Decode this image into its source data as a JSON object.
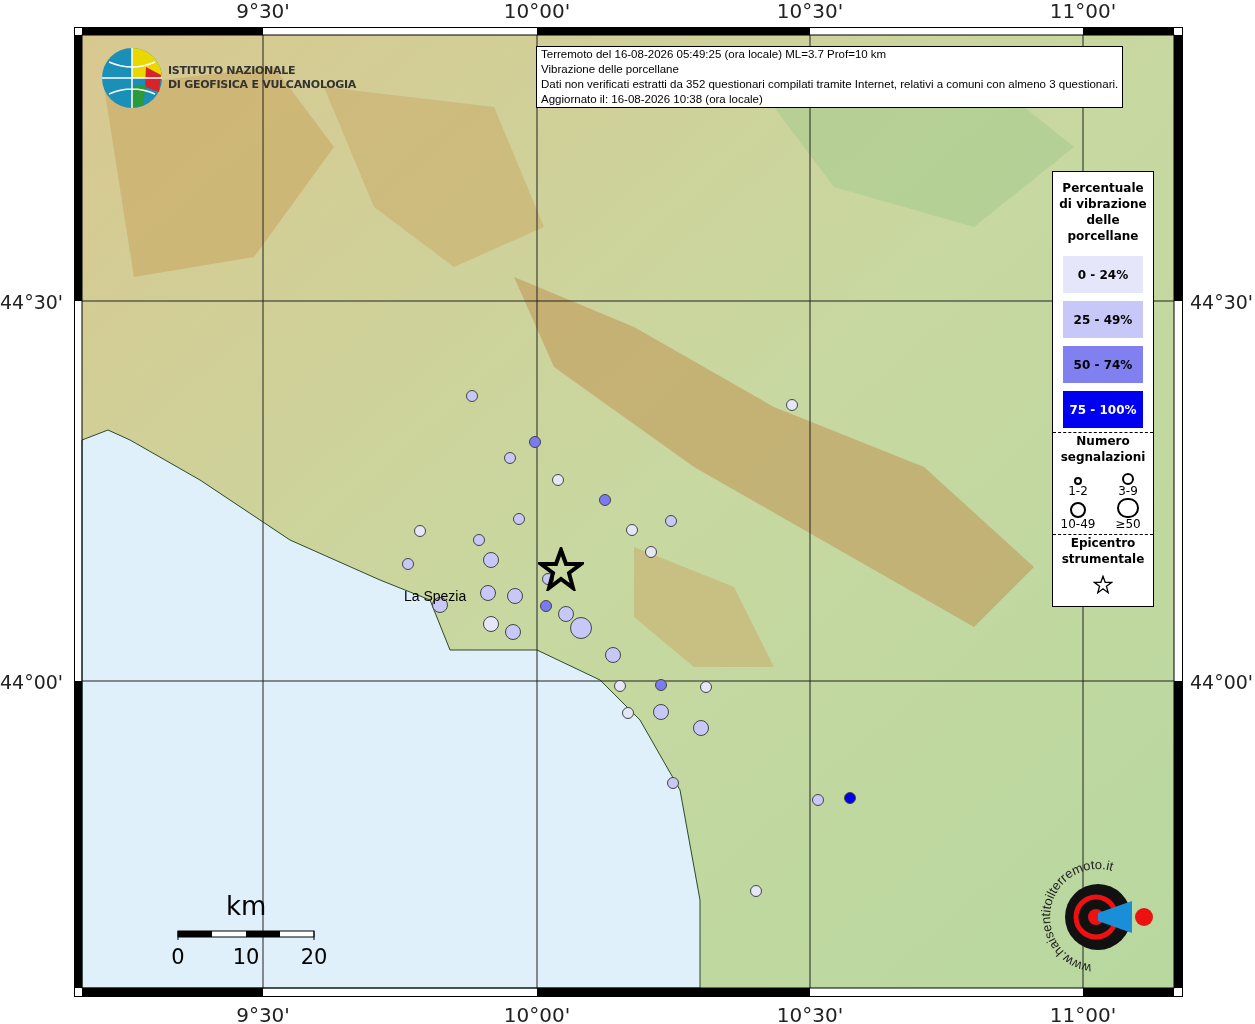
{
  "map": {
    "top_ticks": [
      "9°30'",
      "10°00'",
      "10°30'",
      "11°00'"
    ],
    "bottom_ticks": [
      "9°30'",
      "10°00'",
      "10°30'",
      "11°00'"
    ],
    "left_ticks": [
      "44°30'",
      "44°00'"
    ],
    "right_ticks": [
      "44°30'",
      "44°00'"
    ],
    "city_label": "La Spezia",
    "points": [
      {
        "kind": "small",
        "color": "#c8c8f8"
      },
      {
        "kind": "small",
        "color": "#7b7bf0"
      },
      {
        "kind": "small",
        "color": "#c8c8f8"
      },
      {
        "kind": "small",
        "color": "#e6e6fa"
      },
      {
        "kind": "small",
        "color": "#7b7bf0"
      },
      {
        "kind": "small",
        "color": "#c8c8f8"
      },
      {
        "kind": "small",
        "color": "#e6e6fa"
      },
      {
        "kind": "small",
        "color": "#c8c8f8"
      },
      {
        "kind": "small",
        "color": "#e6e6fa"
      },
      {
        "kind": "small",
        "color": "#c8c8f8"
      },
      {
        "kind": "small",
        "color": "#e6e6fa"
      },
      {
        "kind": "medium",
        "color": "#c8c8f8"
      },
      {
        "kind": "small",
        "color": "#c8c8f8"
      },
      {
        "kind": "small",
        "color": "#c8c8f8"
      },
      {
        "kind": "medium",
        "color": "#c8c8f8"
      },
      {
        "kind": "medium",
        "color": "#c8c8f8"
      },
      {
        "kind": "medium",
        "color": "#c8c8f8"
      },
      {
        "kind": "small",
        "color": "#7b7bf0"
      },
      {
        "kind": "medium",
        "color": "#c8c8f8"
      },
      {
        "kind": "large",
        "color": "#c8c8f8"
      },
      {
        "kind": "medium",
        "color": "#e6e6fa"
      },
      {
        "kind": "medium",
        "color": "#c8c8f8"
      },
      {
        "kind": "medium",
        "color": "#c8c8f8"
      },
      {
        "kind": "small",
        "color": "#e6e6fa"
      },
      {
        "kind": "small",
        "color": "#7b7bf0"
      },
      {
        "kind": "small",
        "color": "#e6e6fa"
      },
      {
        "kind": "small",
        "color": "#e6e6fa"
      },
      {
        "kind": "medium",
        "color": "#c8c8f8"
      },
      {
        "kind": "medium",
        "color": "#c8c8f8"
      },
      {
        "kind": "small",
        "color": "#c8c8f8"
      },
      {
        "kind": "small",
        "color": "#e6e6fa"
      },
      {
        "kind": "small",
        "color": "#c8c8f8"
      },
      {
        "kind": "small",
        "color": "#0000e6"
      },
      {
        "kind": "small",
        "color": "#e6e6fa"
      }
    ],
    "scale": {
      "unit": "km",
      "labels": [
        "0",
        "10",
        "20"
      ]
    }
  },
  "institute_logo": [
    "ISTITUTO NAZIONALE",
    "DI GEOFISICA E VULCANOLOGIA"
  ],
  "info_box": [
    "Terremoto del 16-08-2026 05:49:25 (ora locale) ML=3.7 Prof=10 km",
    "Vibrazione delle porcellane",
    "Dati non verificati estratti da 352 questionari compilati tramite Internet, relativi a comuni con almeno 3 questionari.",
    "Aggiornato il: 16-08-2026 10:38 (ora locale)"
  ],
  "legend": {
    "title": "Percentuale di vibrazione delle porcellane",
    "categories": [
      {
        "label": "0 - 24%",
        "color": "#e6e6fa"
      },
      {
        "label": "25 - 49%",
        "color": "#c8c8f8"
      },
      {
        "label": "50 - 74%",
        "color": "#8080f0"
      },
      {
        "label": "75 - 100%",
        "color": "#0000f0"
      }
    ],
    "count_title": "Numero segnalazioni",
    "count_sizes": [
      {
        "kind": "tiny",
        "label": "1-2"
      },
      {
        "kind": "small",
        "label": "3-9"
      },
      {
        "kind": "medium",
        "label": "10-49"
      },
      {
        "kind": "large",
        "label": "≥50"
      }
    ],
    "epicenter_title": "Epicentro strumentale"
  },
  "site_logo": {
    "text": "www.haisentitoilterremoto.it"
  }
}
